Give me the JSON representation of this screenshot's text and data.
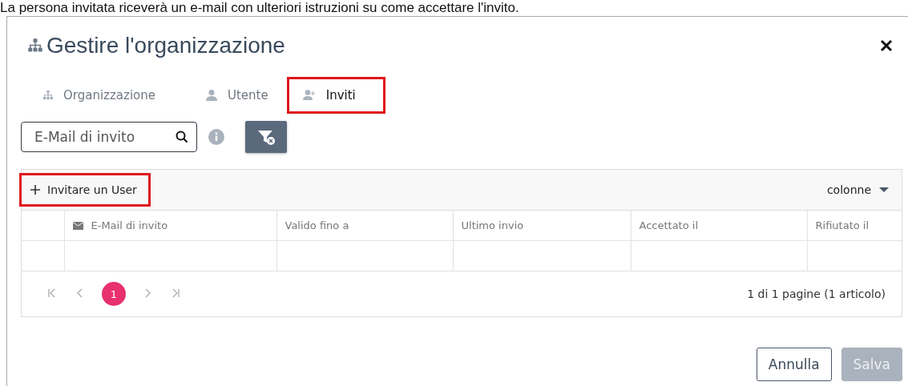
{
  "caption": "La persona invitata riceverà un e-mail con ulteriori istruzioni su come accettare l'invito.",
  "dialog": {
    "title": "Gestire l'organizzazione",
    "tabs": [
      {
        "label": "Organizzazione",
        "kind": "org",
        "selected": false,
        "highlighted": false
      },
      {
        "label": "Utente",
        "kind": "user",
        "selected": false,
        "highlighted": false
      },
      {
        "label": "Inviti",
        "kind": "invite",
        "selected": true,
        "highlighted": true
      }
    ],
    "search": {
      "placeholder": "E-Mail di invito"
    },
    "toolbar": {
      "add_button": {
        "label": "Invitare un User",
        "highlighted": true
      },
      "columns_menu": "colonne"
    },
    "table": {
      "columns": [
        {
          "kind": "select"
        },
        {
          "label": "E-Mail di invito",
          "kind": "email"
        },
        {
          "label": "Valido fino a",
          "kind": "text"
        },
        {
          "label": "Ultimo invio",
          "kind": "text"
        },
        {
          "label": "Accettato il",
          "kind": "text"
        },
        {
          "label": "Rifiutato il",
          "kind": "text"
        }
      ]
    },
    "pager": {
      "pages": [
        {
          "label": "1",
          "selected": true
        }
      ],
      "summary": "1 di 1 pagine (1 articolo)"
    },
    "buttons": [
      {
        "label": "Annulla",
        "disabled": false
      },
      {
        "label": "Salva",
        "disabled": true
      }
    ]
  }
}
